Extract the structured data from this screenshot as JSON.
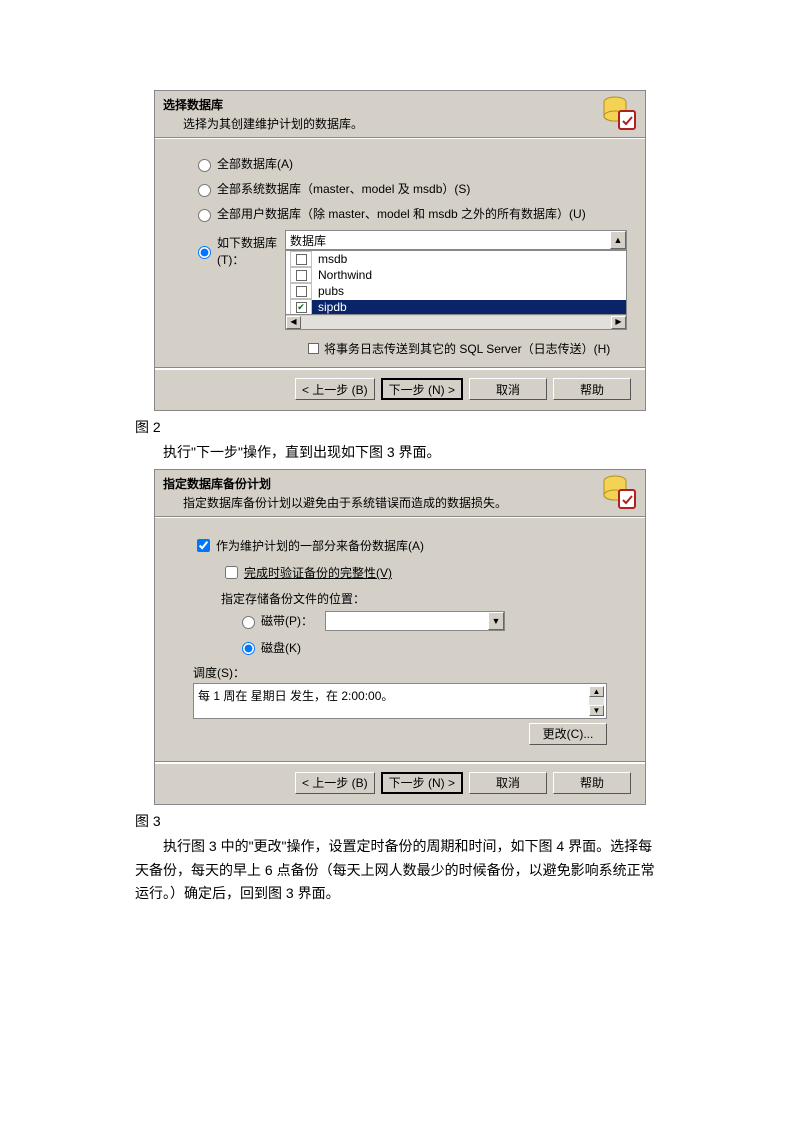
{
  "dialog1": {
    "title": "选择数据库",
    "subtitle": "选择为其创建维护计划的数据库。",
    "radios": {
      "all": "全部数据库(A)",
      "system": "全部系统数据库（master、model 及 msdb）(S)",
      "user": "全部用户数据库（除 master、model 和 msdb 之外的所有数据库）(U)",
      "these_label": "如下数据库(T)：",
      "combo_label": "数据库"
    },
    "db_items": [
      {
        "name": "msdb",
        "checked": false,
        "selected": false
      },
      {
        "name": "Northwind",
        "checked": false,
        "selected": false
      },
      {
        "name": "pubs",
        "checked": false,
        "selected": false
      },
      {
        "name": "sipdb",
        "checked": true,
        "selected": true
      }
    ],
    "log_ship": "将事务日志传送到其它的 SQL Server（日志传送）(H)"
  },
  "buttons": {
    "back": "< 上一步 (B)",
    "next": "下一步 (N) >",
    "cancel": "取消",
    "help": "帮助",
    "change": "更改(C)..."
  },
  "caption1": "图 2",
  "para1": "执行\"下一步\"操作，直到出现如下图 3 界面。",
  "dialog2": {
    "title": "指定数据库备份计划",
    "subtitle": "指定数据库备份计划以避免由于系统错误而造成的数据损失。",
    "backup_as_plan": "作为维护计划的一部分来备份数据库(A)",
    "verify": "完成时验证备份的完整性(V)",
    "location_label": "指定存储备份文件的位置：",
    "tape": "磁带(P)：",
    "disk": "磁盘(K)",
    "sched_label": "调度(S)：",
    "sched_text": "每 1 周在 星期日 发生，在 2:00:00。"
  },
  "caption2": "图 3",
  "para2": "执行图 3 中的\"更改\"操作，设置定时备份的周期和时间，如下图 4 界面。选择每天备份，每天的早上 6 点备份（每天上网人数最少的时候备份，以避免影响系统正常运行。）确定后，回到图 3 界面。"
}
